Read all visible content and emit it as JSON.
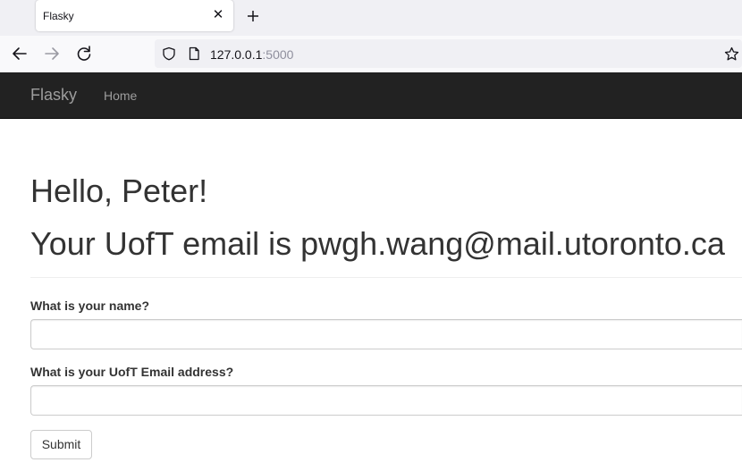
{
  "browser": {
    "tab_title": "Flasky",
    "tab_close_icon": "close-icon",
    "new_tab_icon": "plus-icon",
    "url_host": "127.0.0.1",
    "url_port": ":5000",
    "icons": [
      "back-arrow-icon",
      "forward-arrow-icon",
      "reload-icon",
      "shield-icon",
      "page-icon",
      "star-icon"
    ]
  },
  "navbar": {
    "brand": "Flasky",
    "links": [
      {
        "label": "Home"
      }
    ],
    "background": "#222222",
    "text_color": "#9d9d9d"
  },
  "main": {
    "greeting": "Hello, Peter!",
    "email_line": "Your UofT email is pwgh.wang@mail.utoronto.ca"
  },
  "form": {
    "name_label": "What is your name?",
    "name_value": "",
    "email_label": "What is your UofT Email address?",
    "email_value": "",
    "submit_label": "Submit"
  }
}
